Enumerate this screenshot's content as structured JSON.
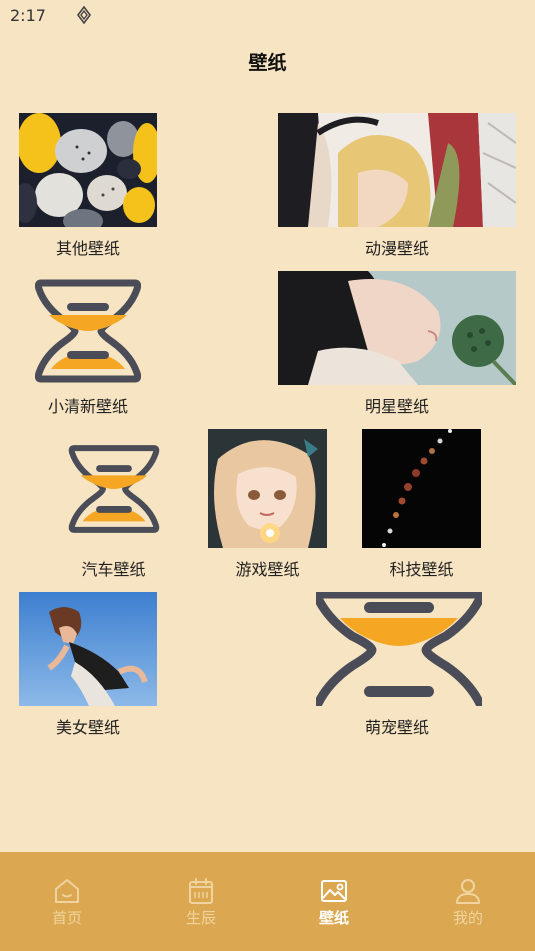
{
  "status": {
    "time": "2:17"
  },
  "header": {
    "title": "壁纸"
  },
  "categories": [
    {
      "label": "其他壁纸",
      "image": "colorful-pebbles-photo"
    },
    {
      "label": "动漫壁纸",
      "image": "anime-characters-photo"
    },
    {
      "label": "小清新壁纸",
      "image": "hourglass-placeholder-icon"
    },
    {
      "label": "明星壁纸",
      "image": "woman-with-lotus-photo"
    },
    {
      "label": "汽车壁纸",
      "image": "hourglass-placeholder-icon"
    },
    {
      "label": "游戏壁纸",
      "image": "anime-girl-sparkler-photo"
    },
    {
      "label": "科技壁纸",
      "image": "lunar-eclipse-photo"
    },
    {
      "label": "美女壁纸",
      "image": "woman-blue-sky-photo"
    },
    {
      "label": "萌宠壁纸",
      "image": "hourglass-placeholder-icon"
    }
  ],
  "tabbar": {
    "active": "壁纸",
    "tabs": [
      {
        "label": "首页",
        "icon": "home-icon"
      },
      {
        "label": "生辰",
        "icon": "calendar-icon"
      },
      {
        "label": "壁纸",
        "icon": "image-icon"
      },
      {
        "label": "我的",
        "icon": "user-icon"
      }
    ]
  },
  "colors": {
    "background": "#f7e4c3",
    "tabbar": "#dba851",
    "hourglass_sand": "#f5a623",
    "hourglass_frame": "#4a4d57"
  }
}
